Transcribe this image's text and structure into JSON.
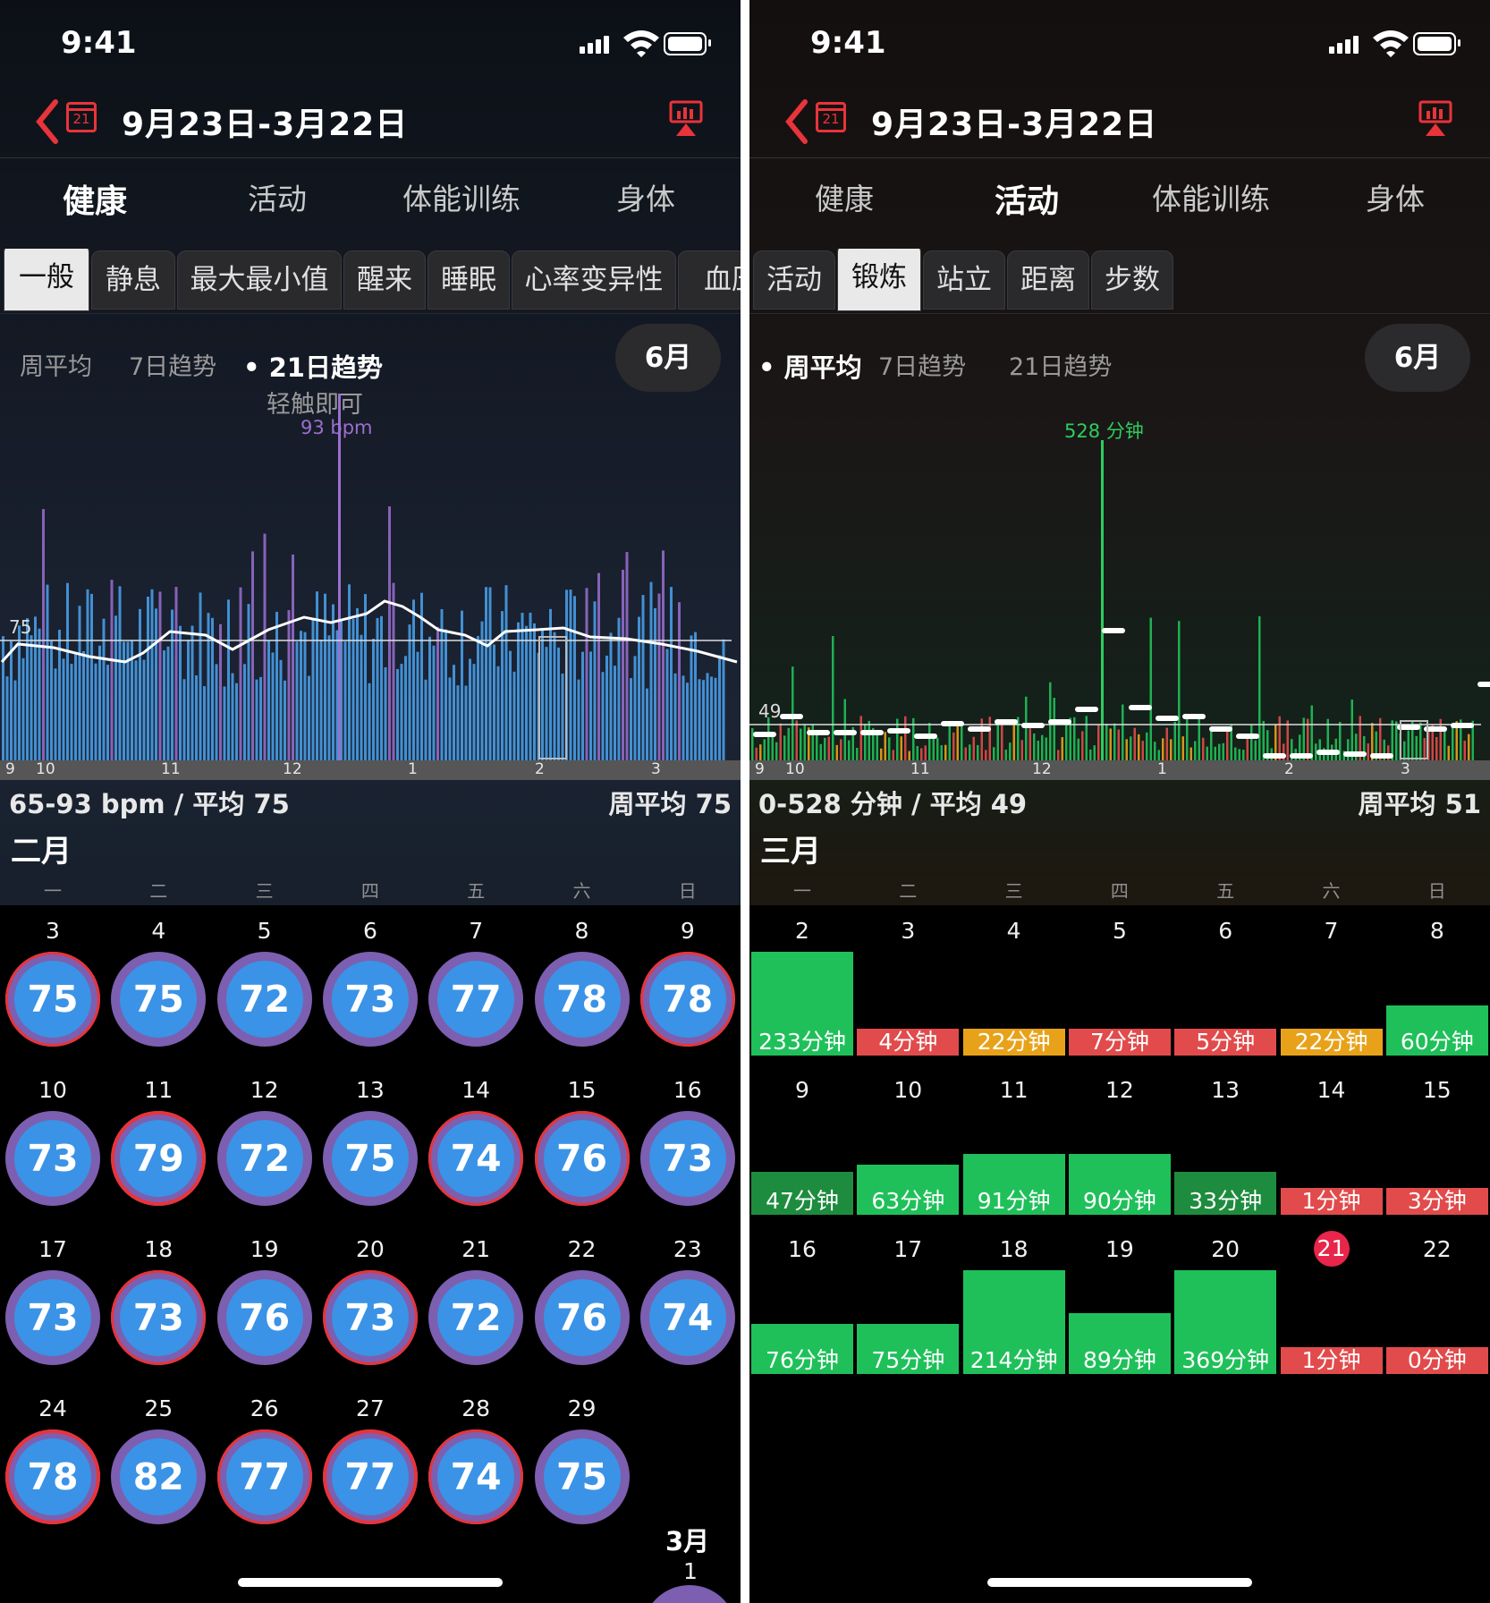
{
  "status": {
    "time": "9:41"
  },
  "nav": {
    "title": "9月23日-3月22日",
    "calendar_day": "21"
  },
  "left": {
    "tabs": [
      {
        "label": "健康",
        "active": true
      },
      {
        "label": "活动",
        "active": false
      },
      {
        "label": "体能训练",
        "active": false
      },
      {
        "label": "身体",
        "active": false
      }
    ],
    "subtabs": [
      {
        "label": "一般",
        "active": true
      },
      {
        "label": "静息",
        "active": false
      },
      {
        "label": "最大最小值",
        "active": false
      },
      {
        "label": "醒来",
        "active": false
      },
      {
        "label": "睡眠",
        "active": false
      },
      {
        "label": "心率变异性",
        "active": false
      },
      {
        "label": "血压",
        "active": false
      }
    ],
    "periods": [
      {
        "label": "周平均",
        "selected": false
      },
      {
        "label": "7日趋势",
        "selected": false
      },
      {
        "label": "• 21日趋势",
        "selected": true
      }
    ],
    "month_button": "6月",
    "hint": "轻触即可",
    "peak_label": "93 bpm",
    "avg_marker": "75",
    "axis_ticks": [
      "9",
      "10",
      "11",
      "12",
      "1",
      "2",
      "3"
    ],
    "range_text": "65-93 bpm / 平均 75",
    "weekly_avg_text": "周平均 75",
    "month_title": "二月",
    "weekdays": [
      "一",
      "二",
      "三",
      "四",
      "五",
      "六",
      "日"
    ],
    "weeks": [
      [
        {
          "d": "3",
          "v": "75",
          "ring": "purple-red"
        },
        {
          "d": "4",
          "v": "75",
          "ring": "purple"
        },
        {
          "d": "5",
          "v": "72",
          "ring": "blue"
        },
        {
          "d": "6",
          "v": "73",
          "ring": "purple"
        },
        {
          "d": "7",
          "v": "77",
          "ring": "purple"
        },
        {
          "d": "8",
          "v": "78",
          "ring": "purple"
        },
        {
          "d": "9",
          "v": "78",
          "ring": "purple-red"
        }
      ],
      [
        {
          "d": "10",
          "v": "73",
          "ring": "purple"
        },
        {
          "d": "11",
          "v": "79",
          "ring": "red"
        },
        {
          "d": "12",
          "v": "72",
          "ring": "blue"
        },
        {
          "d": "13",
          "v": "75",
          "ring": "purple"
        },
        {
          "d": "14",
          "v": "74",
          "ring": "purple-red"
        },
        {
          "d": "15",
          "v": "76",
          "ring": "purple-red"
        },
        {
          "d": "16",
          "v": "73",
          "ring": "purple"
        }
      ],
      [
        {
          "d": "17",
          "v": "73",
          "ring": "purple"
        },
        {
          "d": "18",
          "v": "73",
          "ring": "purple-red"
        },
        {
          "d": "19",
          "v": "76",
          "ring": "purple"
        },
        {
          "d": "20",
          "v": "73",
          "ring": "purple-red"
        },
        {
          "d": "21",
          "v": "72",
          "ring": "purple"
        },
        {
          "d": "22",
          "v": "76",
          "ring": "purple"
        },
        {
          "d": "23",
          "v": "74",
          "ring": "purple"
        }
      ],
      [
        {
          "d": "24",
          "v": "78",
          "ring": "red"
        },
        {
          "d": "25",
          "v": "82",
          "ring": "purple"
        },
        {
          "d": "26",
          "v": "77",
          "ring": "purple-red"
        },
        {
          "d": "27",
          "v": "77",
          "ring": "red"
        },
        {
          "d": "28",
          "v": "74",
          "ring": "purple-red"
        },
        {
          "d": "29",
          "v": "75",
          "ring": "purple"
        }
      ]
    ],
    "next_month_label": "3月",
    "next_month_day": "1"
  },
  "right": {
    "tabs": [
      {
        "label": "健康",
        "active": false
      },
      {
        "label": "活动",
        "active": true
      },
      {
        "label": "体能训练",
        "active": false
      },
      {
        "label": "身体",
        "active": false
      }
    ],
    "subtabs": [
      {
        "label": "活动",
        "active": false
      },
      {
        "label": "锻炼",
        "active": true
      },
      {
        "label": "站立",
        "active": false
      },
      {
        "label": "距离",
        "active": false
      },
      {
        "label": "步数",
        "active": false
      }
    ],
    "periods": [
      {
        "label": "• 周平均",
        "selected": true
      },
      {
        "label": "7日趋势",
        "selected": false
      },
      {
        "label": "21日趋势",
        "selected": false
      }
    ],
    "month_button": "6月",
    "peak_label": "528 分钟",
    "avg_marker": "49",
    "axis_ticks": [
      "9",
      "10",
      "11",
      "12",
      "1",
      "2",
      "3"
    ],
    "range_text": "0-528 分钟 / 平均 49",
    "weekly_avg_text": "周平均 51",
    "month_title": "三月",
    "weekdays": [
      "一",
      "二",
      "三",
      "四",
      "五",
      "六",
      "日"
    ],
    "weeks": [
      [
        {
          "d": "2",
          "v": "233分钟",
          "mins": 233,
          "color": "green"
        },
        {
          "d": "3",
          "v": "4分钟",
          "mins": 4,
          "color": "red"
        },
        {
          "d": "4",
          "v": "22分钟",
          "mins": 22,
          "color": "orange"
        },
        {
          "d": "5",
          "v": "7分钟",
          "mins": 7,
          "color": "red"
        },
        {
          "d": "6",
          "v": "5分钟",
          "mins": 5,
          "color": "red"
        },
        {
          "d": "7",
          "v": "22分钟",
          "mins": 22,
          "color": "orange"
        },
        {
          "d": "8",
          "v": "60分钟",
          "mins": 60,
          "color": "green"
        }
      ],
      [
        {
          "d": "9",
          "v": "47分钟",
          "mins": 47,
          "color": "darkgreen"
        },
        {
          "d": "10",
          "v": "63分钟",
          "mins": 63,
          "color": "green"
        },
        {
          "d": "11",
          "v": "91分钟",
          "mins": 91,
          "color": "green"
        },
        {
          "d": "12",
          "v": "90分钟",
          "mins": 90,
          "color": "green"
        },
        {
          "d": "13",
          "v": "33分钟",
          "mins": 33,
          "color": "darkgreen"
        },
        {
          "d": "14",
          "v": "1分钟",
          "mins": 1,
          "color": "red"
        },
        {
          "d": "15",
          "v": "3分钟",
          "mins": 3,
          "color": "red"
        }
      ],
      [
        {
          "d": "16",
          "v": "76分钟",
          "mins": 76,
          "color": "green"
        },
        {
          "d": "17",
          "v": "75分钟",
          "mins": 75,
          "color": "green"
        },
        {
          "d": "18",
          "v": "214分钟",
          "mins": 214,
          "color": "green"
        },
        {
          "d": "19",
          "v": "89分钟",
          "mins": 89,
          "color": "green"
        },
        {
          "d": "20",
          "v": "369分钟",
          "mins": 369,
          "color": "green"
        },
        {
          "d": "21",
          "v": "1分钟",
          "mins": 1,
          "color": "red",
          "today": true
        },
        {
          "d": "22",
          "v": "0分钟",
          "mins": 0,
          "color": "red"
        }
      ]
    ]
  },
  "colors": {
    "accent_red": "#e8343a",
    "circle_blue": "#3a93e6",
    "ring_purple": "#7c5fb0",
    "ring_red": "#e8343a",
    "bar_green": "#1fc05a",
    "bar_darkgreen": "#1e8c3e",
    "bar_red": "#e14b4b",
    "bar_orange": "#e8a21a",
    "hr_bar": "#4aa3f0",
    "hr_spike": "#9b6fd0"
  },
  "icons": [
    "chevron-left-icon",
    "calendar-icon",
    "chart-share-icon",
    "signal-icon",
    "wifi-icon",
    "battery-icon"
  ]
}
